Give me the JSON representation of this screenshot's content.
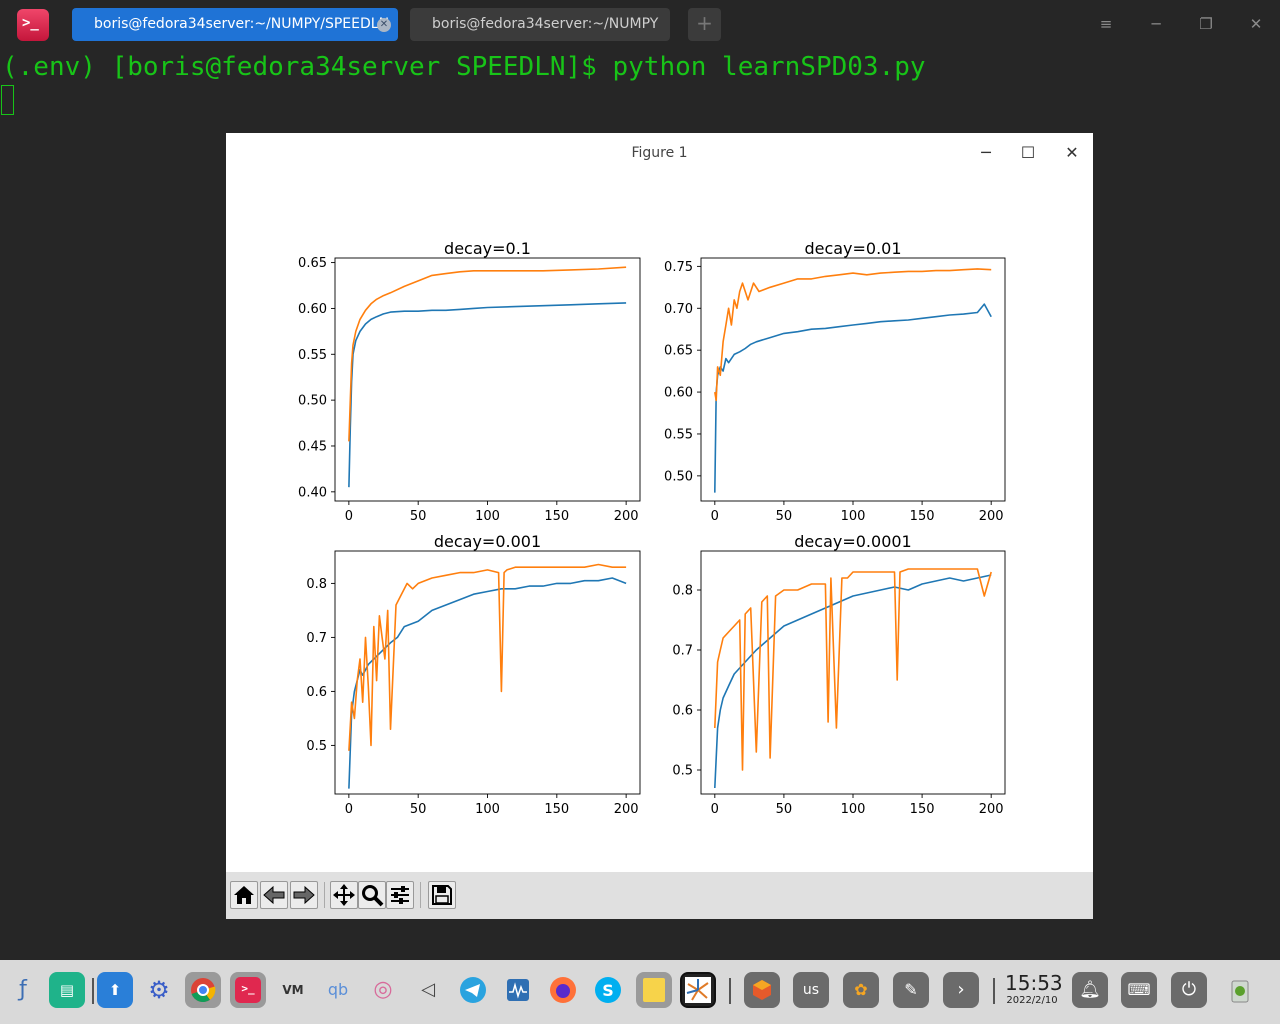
{
  "window": {
    "tabs": [
      {
        "label": "boris@fedora34server:~/NUMPY/SPEEDLN",
        "active": true
      },
      {
        "label": "boris@fedora34server:~/NUMPY",
        "active": false
      }
    ],
    "app_icon_glyph": ">_"
  },
  "terminal": {
    "prompt_line": "(.env) [boris@fedora34server SPEEDLN]$ python learnSPD03.py"
  },
  "figure": {
    "title": "Figure 1"
  },
  "chart_data": [
    {
      "type": "line",
      "title": "decay=0.1",
      "xlim": [
        0,
        200
      ],
      "ylim": [
        0.39,
        0.655
      ],
      "xticks": [
        0,
        50,
        100,
        150,
        200
      ],
      "yticks": [
        0.4,
        0.45,
        0.5,
        0.55,
        0.6,
        0.65
      ],
      "series": [
        {
          "color": "#1f77b4",
          "x": [
            0,
            1,
            2,
            3,
            5,
            8,
            12,
            16,
            20,
            25,
            30,
            40,
            50,
            60,
            70,
            80,
            90,
            100,
            120,
            140,
            160,
            180,
            200
          ],
          "y": [
            0.405,
            0.47,
            0.52,
            0.55,
            0.565,
            0.575,
            0.583,
            0.588,
            0.591,
            0.594,
            0.596,
            0.597,
            0.597,
            0.598,
            0.598,
            0.599,
            0.6,
            0.601,
            0.602,
            0.603,
            0.604,
            0.605,
            0.606
          ]
        },
        {
          "color": "#ff7f0e",
          "x": [
            0,
            1,
            2,
            3,
            5,
            8,
            12,
            16,
            20,
            25,
            30,
            40,
            50,
            60,
            70,
            80,
            90,
            100,
            120,
            140,
            160,
            180,
            200
          ],
          "y": [
            0.455,
            0.5,
            0.54,
            0.56,
            0.575,
            0.588,
            0.598,
            0.605,
            0.61,
            0.614,
            0.617,
            0.624,
            0.63,
            0.636,
            0.638,
            0.64,
            0.641,
            0.641,
            0.641,
            0.641,
            0.642,
            0.643,
            0.645
          ]
        }
      ]
    },
    {
      "type": "line",
      "title": "decay=0.01",
      "xlim": [
        0,
        200
      ],
      "ylim": [
        0.47,
        0.76
      ],
      "xticks": [
        0,
        50,
        100,
        150,
        200
      ],
      "yticks": [
        0.5,
        0.55,
        0.6,
        0.65,
        0.7,
        0.75
      ],
      "series": [
        {
          "color": "#1f77b4",
          "x": [
            0,
            1,
            2,
            4,
            6,
            8,
            10,
            14,
            18,
            22,
            26,
            30,
            40,
            50,
            60,
            70,
            80,
            90,
            100,
            110,
            120,
            130,
            140,
            150,
            160,
            170,
            180,
            190,
            195,
            200
          ],
          "y": [
            0.48,
            0.6,
            0.62,
            0.63,
            0.625,
            0.64,
            0.635,
            0.645,
            0.648,
            0.652,
            0.657,
            0.66,
            0.665,
            0.67,
            0.672,
            0.675,
            0.676,
            0.678,
            0.68,
            0.682,
            0.684,
            0.685,
            0.686,
            0.688,
            0.69,
            0.692,
            0.693,
            0.695,
            0.705,
            0.69
          ]
        },
        {
          "color": "#ff7f0e",
          "x": [
            0,
            1,
            2,
            4,
            6,
            8,
            10,
            12,
            14,
            16,
            18,
            20,
            24,
            28,
            32,
            40,
            50,
            60,
            70,
            80,
            90,
            100,
            110,
            120,
            130,
            140,
            150,
            160,
            170,
            180,
            190,
            200
          ],
          "y": [
            0.6,
            0.59,
            0.63,
            0.62,
            0.66,
            0.68,
            0.7,
            0.68,
            0.71,
            0.7,
            0.72,
            0.73,
            0.71,
            0.73,
            0.72,
            0.725,
            0.73,
            0.735,
            0.735,
            0.738,
            0.74,
            0.742,
            0.74,
            0.742,
            0.743,
            0.744,
            0.744,
            0.745,
            0.745,
            0.746,
            0.747,
            0.746
          ]
        }
      ]
    },
    {
      "type": "line",
      "title": "decay=0.001",
      "xlim": [
        0,
        200
      ],
      "ylim": [
        0.41,
        0.86
      ],
      "xticks": [
        0,
        50,
        100,
        150,
        200
      ],
      "yticks": [
        0.5,
        0.6,
        0.7,
        0.8
      ],
      "series": [
        {
          "color": "#1f77b4",
          "x": [
            0,
            2,
            4,
            6,
            8,
            10,
            14,
            18,
            22,
            26,
            30,
            35,
            40,
            50,
            60,
            70,
            80,
            90,
            100,
            110,
            120,
            130,
            140,
            150,
            160,
            170,
            180,
            190,
            200
          ],
          "y": [
            0.42,
            0.56,
            0.6,
            0.62,
            0.64,
            0.63,
            0.65,
            0.66,
            0.67,
            0.68,
            0.69,
            0.7,
            0.72,
            0.73,
            0.75,
            0.76,
            0.77,
            0.78,
            0.785,
            0.79,
            0.79,
            0.795,
            0.795,
            0.8,
            0.8,
            0.805,
            0.805,
            0.81,
            0.8
          ]
        },
        {
          "color": "#ff7f0e",
          "x": [
            0,
            2,
            4,
            6,
            8,
            10,
            12,
            14,
            16,
            18,
            20,
            22,
            24,
            26,
            28,
            30,
            34,
            38,
            42,
            46,
            50,
            60,
            70,
            80,
            90,
            100,
            108,
            110,
            112,
            114,
            120,
            130,
            140,
            150,
            160,
            170,
            180,
            190,
            200
          ],
          "y": [
            0.49,
            0.58,
            0.55,
            0.62,
            0.66,
            0.58,
            0.7,
            0.61,
            0.5,
            0.72,
            0.62,
            0.74,
            0.7,
            0.66,
            0.75,
            0.53,
            0.76,
            0.78,
            0.8,
            0.79,
            0.8,
            0.81,
            0.815,
            0.82,
            0.82,
            0.825,
            0.82,
            0.6,
            0.82,
            0.825,
            0.83,
            0.83,
            0.83,
            0.83,
            0.83,
            0.83,
            0.835,
            0.83,
            0.83
          ]
        }
      ]
    },
    {
      "type": "line",
      "title": "decay=0.0001",
      "xlim": [
        0,
        200
      ],
      "ylim": [
        0.46,
        0.865
      ],
      "xticks": [
        0,
        50,
        100,
        150,
        200
      ],
      "yticks": [
        0.5,
        0.6,
        0.7,
        0.8
      ],
      "series": [
        {
          "color": "#1f77b4",
          "x": [
            0,
            2,
            4,
            6,
            10,
            14,
            18,
            22,
            26,
            30,
            40,
            50,
            60,
            70,
            80,
            90,
            100,
            110,
            120,
            130,
            140,
            150,
            160,
            170,
            180,
            190,
            200
          ],
          "y": [
            0.47,
            0.57,
            0.6,
            0.62,
            0.64,
            0.66,
            0.67,
            0.68,
            0.69,
            0.7,
            0.72,
            0.74,
            0.75,
            0.76,
            0.77,
            0.78,
            0.79,
            0.795,
            0.8,
            0.805,
            0.8,
            0.81,
            0.815,
            0.82,
            0.815,
            0.82,
            0.825
          ]
        },
        {
          "color": "#ff7f0e",
          "x": [
            0,
            2,
            4,
            6,
            10,
            14,
            18,
            20,
            22,
            26,
            30,
            34,
            38,
            40,
            44,
            50,
            60,
            70,
            80,
            82,
            84,
            88,
            92,
            96,
            100,
            110,
            120,
            130,
            132,
            134,
            140,
            150,
            160,
            170,
            180,
            190,
            195,
            200
          ],
          "y": [
            0.57,
            0.68,
            0.7,
            0.72,
            0.73,
            0.74,
            0.75,
            0.5,
            0.76,
            0.77,
            0.53,
            0.78,
            0.79,
            0.52,
            0.79,
            0.8,
            0.8,
            0.81,
            0.81,
            0.58,
            0.82,
            0.57,
            0.82,
            0.82,
            0.83,
            0.83,
            0.83,
            0.83,
            0.65,
            0.83,
            0.835,
            0.835,
            0.835,
            0.835,
            0.835,
            0.835,
            0.79,
            0.83
          ]
        }
      ]
    }
  ],
  "taskbar": {
    "clock_time": "15:53",
    "clock_date": "2022/2/10",
    "keyboard_layout": "us"
  }
}
